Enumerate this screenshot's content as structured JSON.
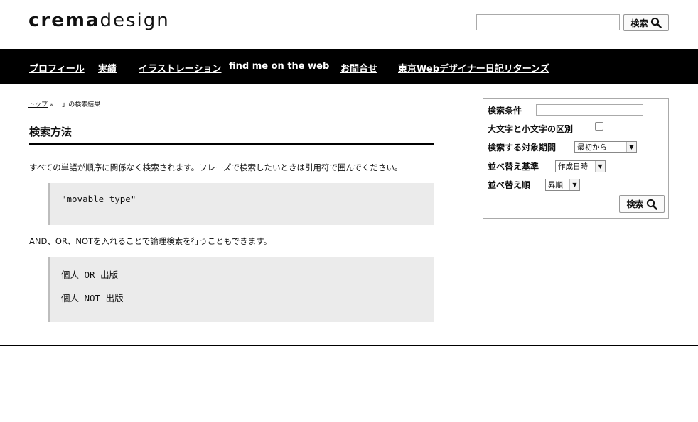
{
  "header": {
    "logo_bold": "crema",
    "logo_light": "design",
    "search_value": "",
    "search_button": "検索",
    "search_icon": "magnifier-icon"
  },
  "nav": {
    "items": [
      "プロフィール",
      "実績",
      "イラストレーション",
      "find me on the web",
      "お問合せ",
      "東京Webデザイナー日記リターンズ"
    ]
  },
  "breadcrumb": {
    "top": "トップ",
    "separator": "»",
    "current": "「」の検索結果"
  },
  "main": {
    "heading": "検索方法",
    "para1": "すべての単語が順序に関係なく検索されます。フレーズで検索したいときは引用符で囲んでください。",
    "example1": "\"movable type\"",
    "para2": "AND、OR、NOTを入れることで論理検索を行うこともできます。",
    "example2": [
      "個人 OR 出版",
      "個人 NOT 出版"
    ]
  },
  "panel": {
    "search_label": "検索条件",
    "search_value": "",
    "case_label": "大文字と小文字の区別",
    "case_checked": false,
    "period_label": "検索する対象期間",
    "period_value": "最初から",
    "sort_label": "並べ替え基準",
    "sort_value": "作成日時",
    "order_label": "並べ替え順",
    "order_value": "昇順",
    "button": "検索"
  }
}
